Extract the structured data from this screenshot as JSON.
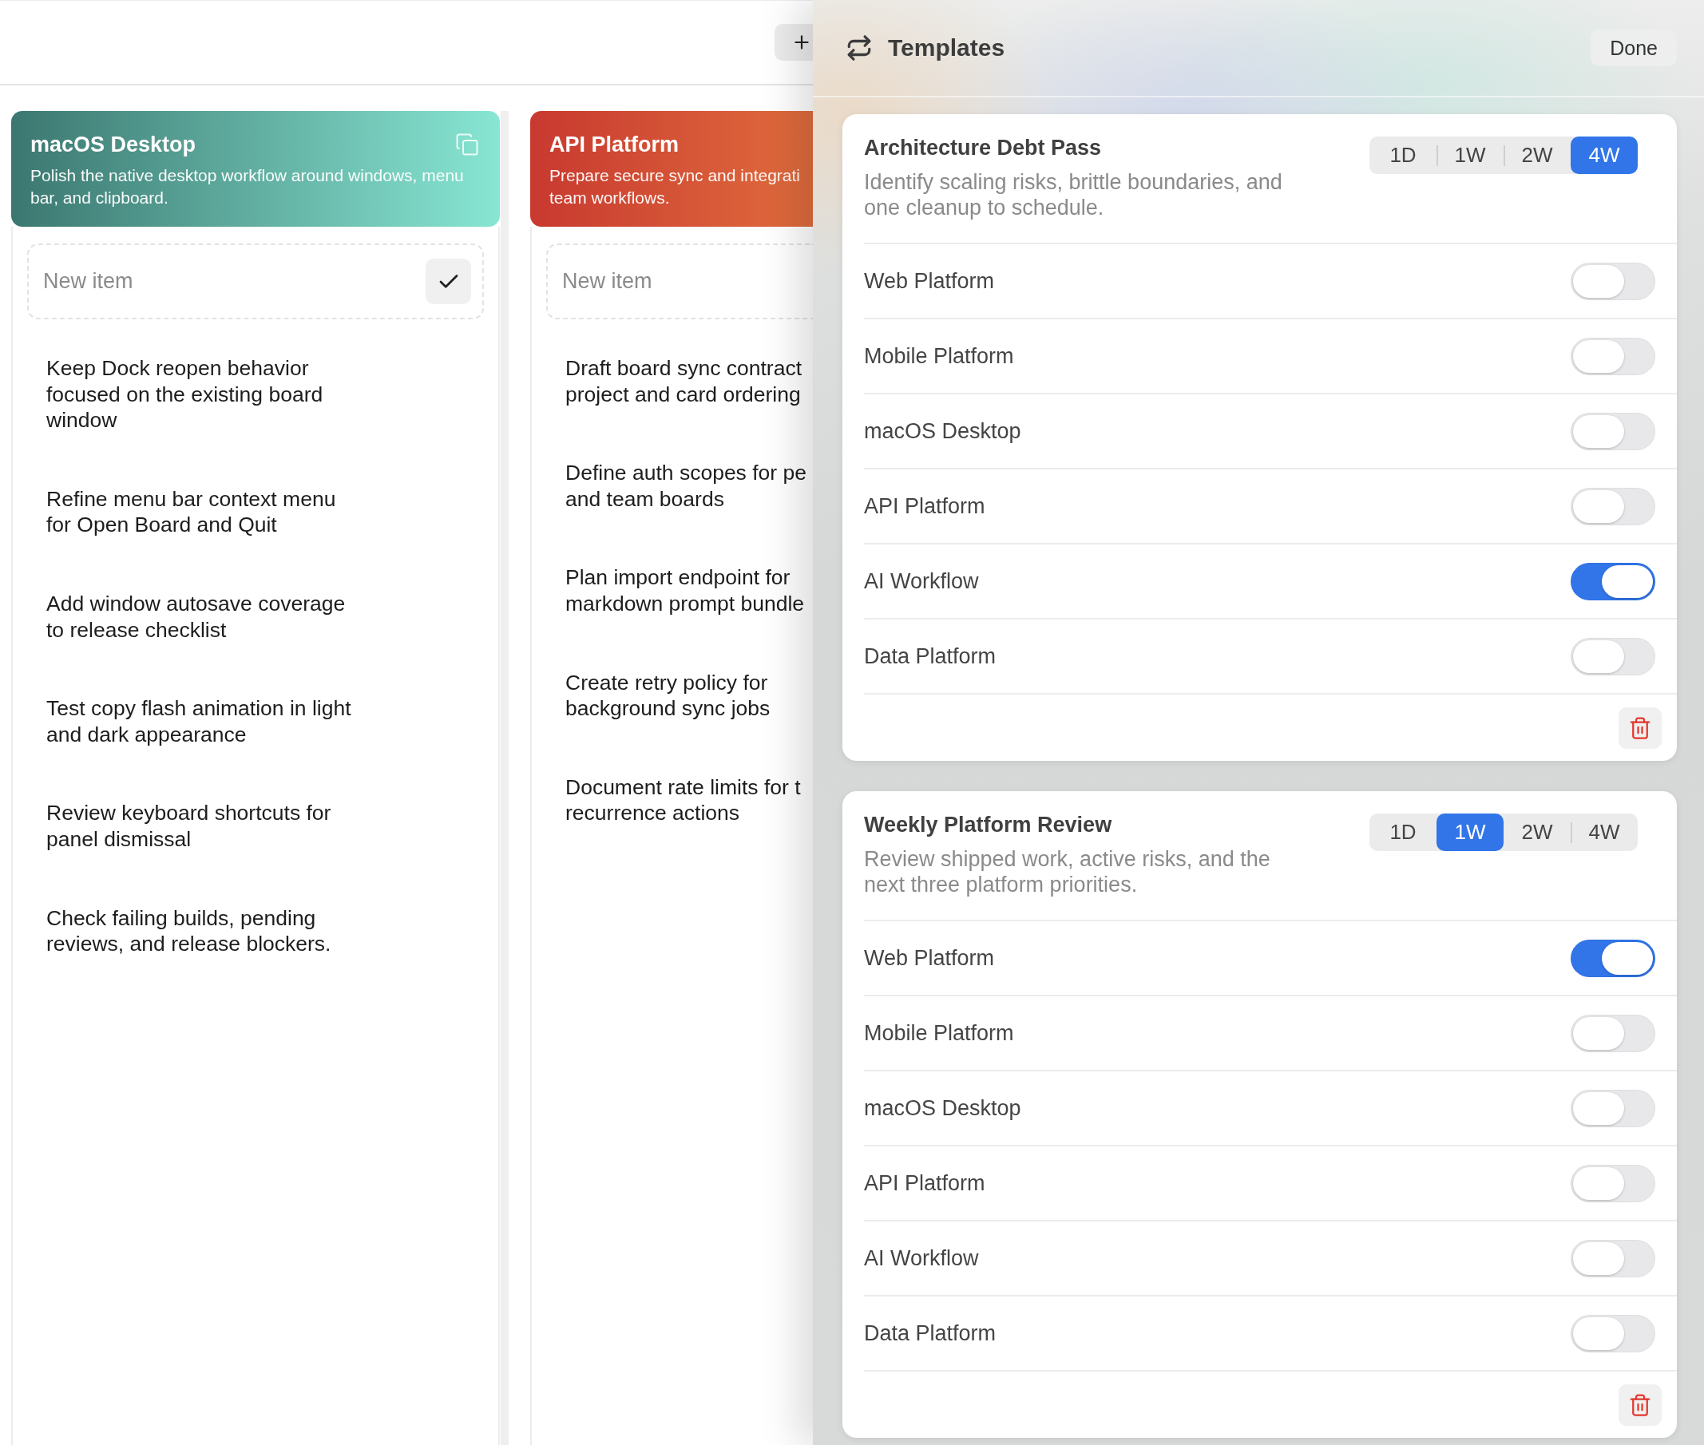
{
  "board": {
    "columns": [
      {
        "title": "macOS Desktop",
        "description": "Polish the native desktop workflow around windows, menu\nbar, and clipboard.",
        "gradient": [
          {
            "color": "#3b7770"
          },
          {
            "color": "#88e6d3"
          }
        ],
        "copy_button": true,
        "new_item": {
          "placeholder": "New item",
          "confirm_button": true
        },
        "items": [
          "Keep Dock reopen behavior\nfocused on the existing board\nwindow",
          "Refine menu bar context menu\nfor Open Board and Quit",
          "Add window autosave coverage\nto release checklist",
          "Test copy flash animation in light\nand dark appearance",
          "Review keyboard shortcuts for\npanel dismissal",
          "Check failing builds, pending\nreviews, and release blockers."
        ]
      },
      {
        "title": "API Platform",
        "description": "Prepare secure sync and integrati\nteam workflows.",
        "gradient": [
          {
            "color": "#c8392f"
          },
          {
            "color": "#e06c3d"
          }
        ],
        "new_item": {
          "placeholder": "New item"
        },
        "items": [
          "Draft board sync contract\nproject and card ordering",
          "Define auth scopes for pe\nand team boards",
          "Plan import endpoint for\nmarkdown prompt bundle",
          "Create retry policy for\nbackground sync jobs",
          "Document rate limits for t\nrecurrence actions"
        ]
      }
    ]
  },
  "templates_panel": {
    "title": "Templates",
    "done_button": "Done",
    "templates": [
      {
        "name": "Architecture Debt Pass",
        "description": "Identify scaling risks, brittle boundaries, and\none cleanup to schedule.",
        "periods": [
          {
            "label": "1D",
            "selected": false
          },
          {
            "label": "1W",
            "selected": false
          },
          {
            "label": "2W",
            "selected": false
          },
          {
            "label": "4W",
            "selected": true
          }
        ],
        "boards": [
          {
            "label": "Web Platform",
            "on": false
          },
          {
            "label": "Mobile Platform",
            "on": false
          },
          {
            "label": "macOS Desktop",
            "on": false
          },
          {
            "label": "API Platform",
            "on": false
          },
          {
            "label": "AI Workflow",
            "on": true
          },
          {
            "label": "Data Platform",
            "on": false
          }
        ]
      },
      {
        "name": "Weekly Platform Review",
        "description": "Review shipped work, active risks, and the\nnext three platform priorities.",
        "periods": [
          {
            "label": "1D",
            "selected": false
          },
          {
            "label": "1W",
            "selected": true
          },
          {
            "label": "2W",
            "selected": false
          },
          {
            "label": "4W",
            "selected": false
          }
        ],
        "boards": [
          {
            "label": "Web Platform",
            "on": true
          },
          {
            "label": "Mobile Platform",
            "on": false
          },
          {
            "label": "macOS Desktop",
            "on": false
          },
          {
            "label": "API Platform",
            "on": false
          },
          {
            "label": "AI Workflow",
            "on": false
          },
          {
            "label": "Data Platform",
            "on": false
          }
        ]
      }
    ]
  }
}
